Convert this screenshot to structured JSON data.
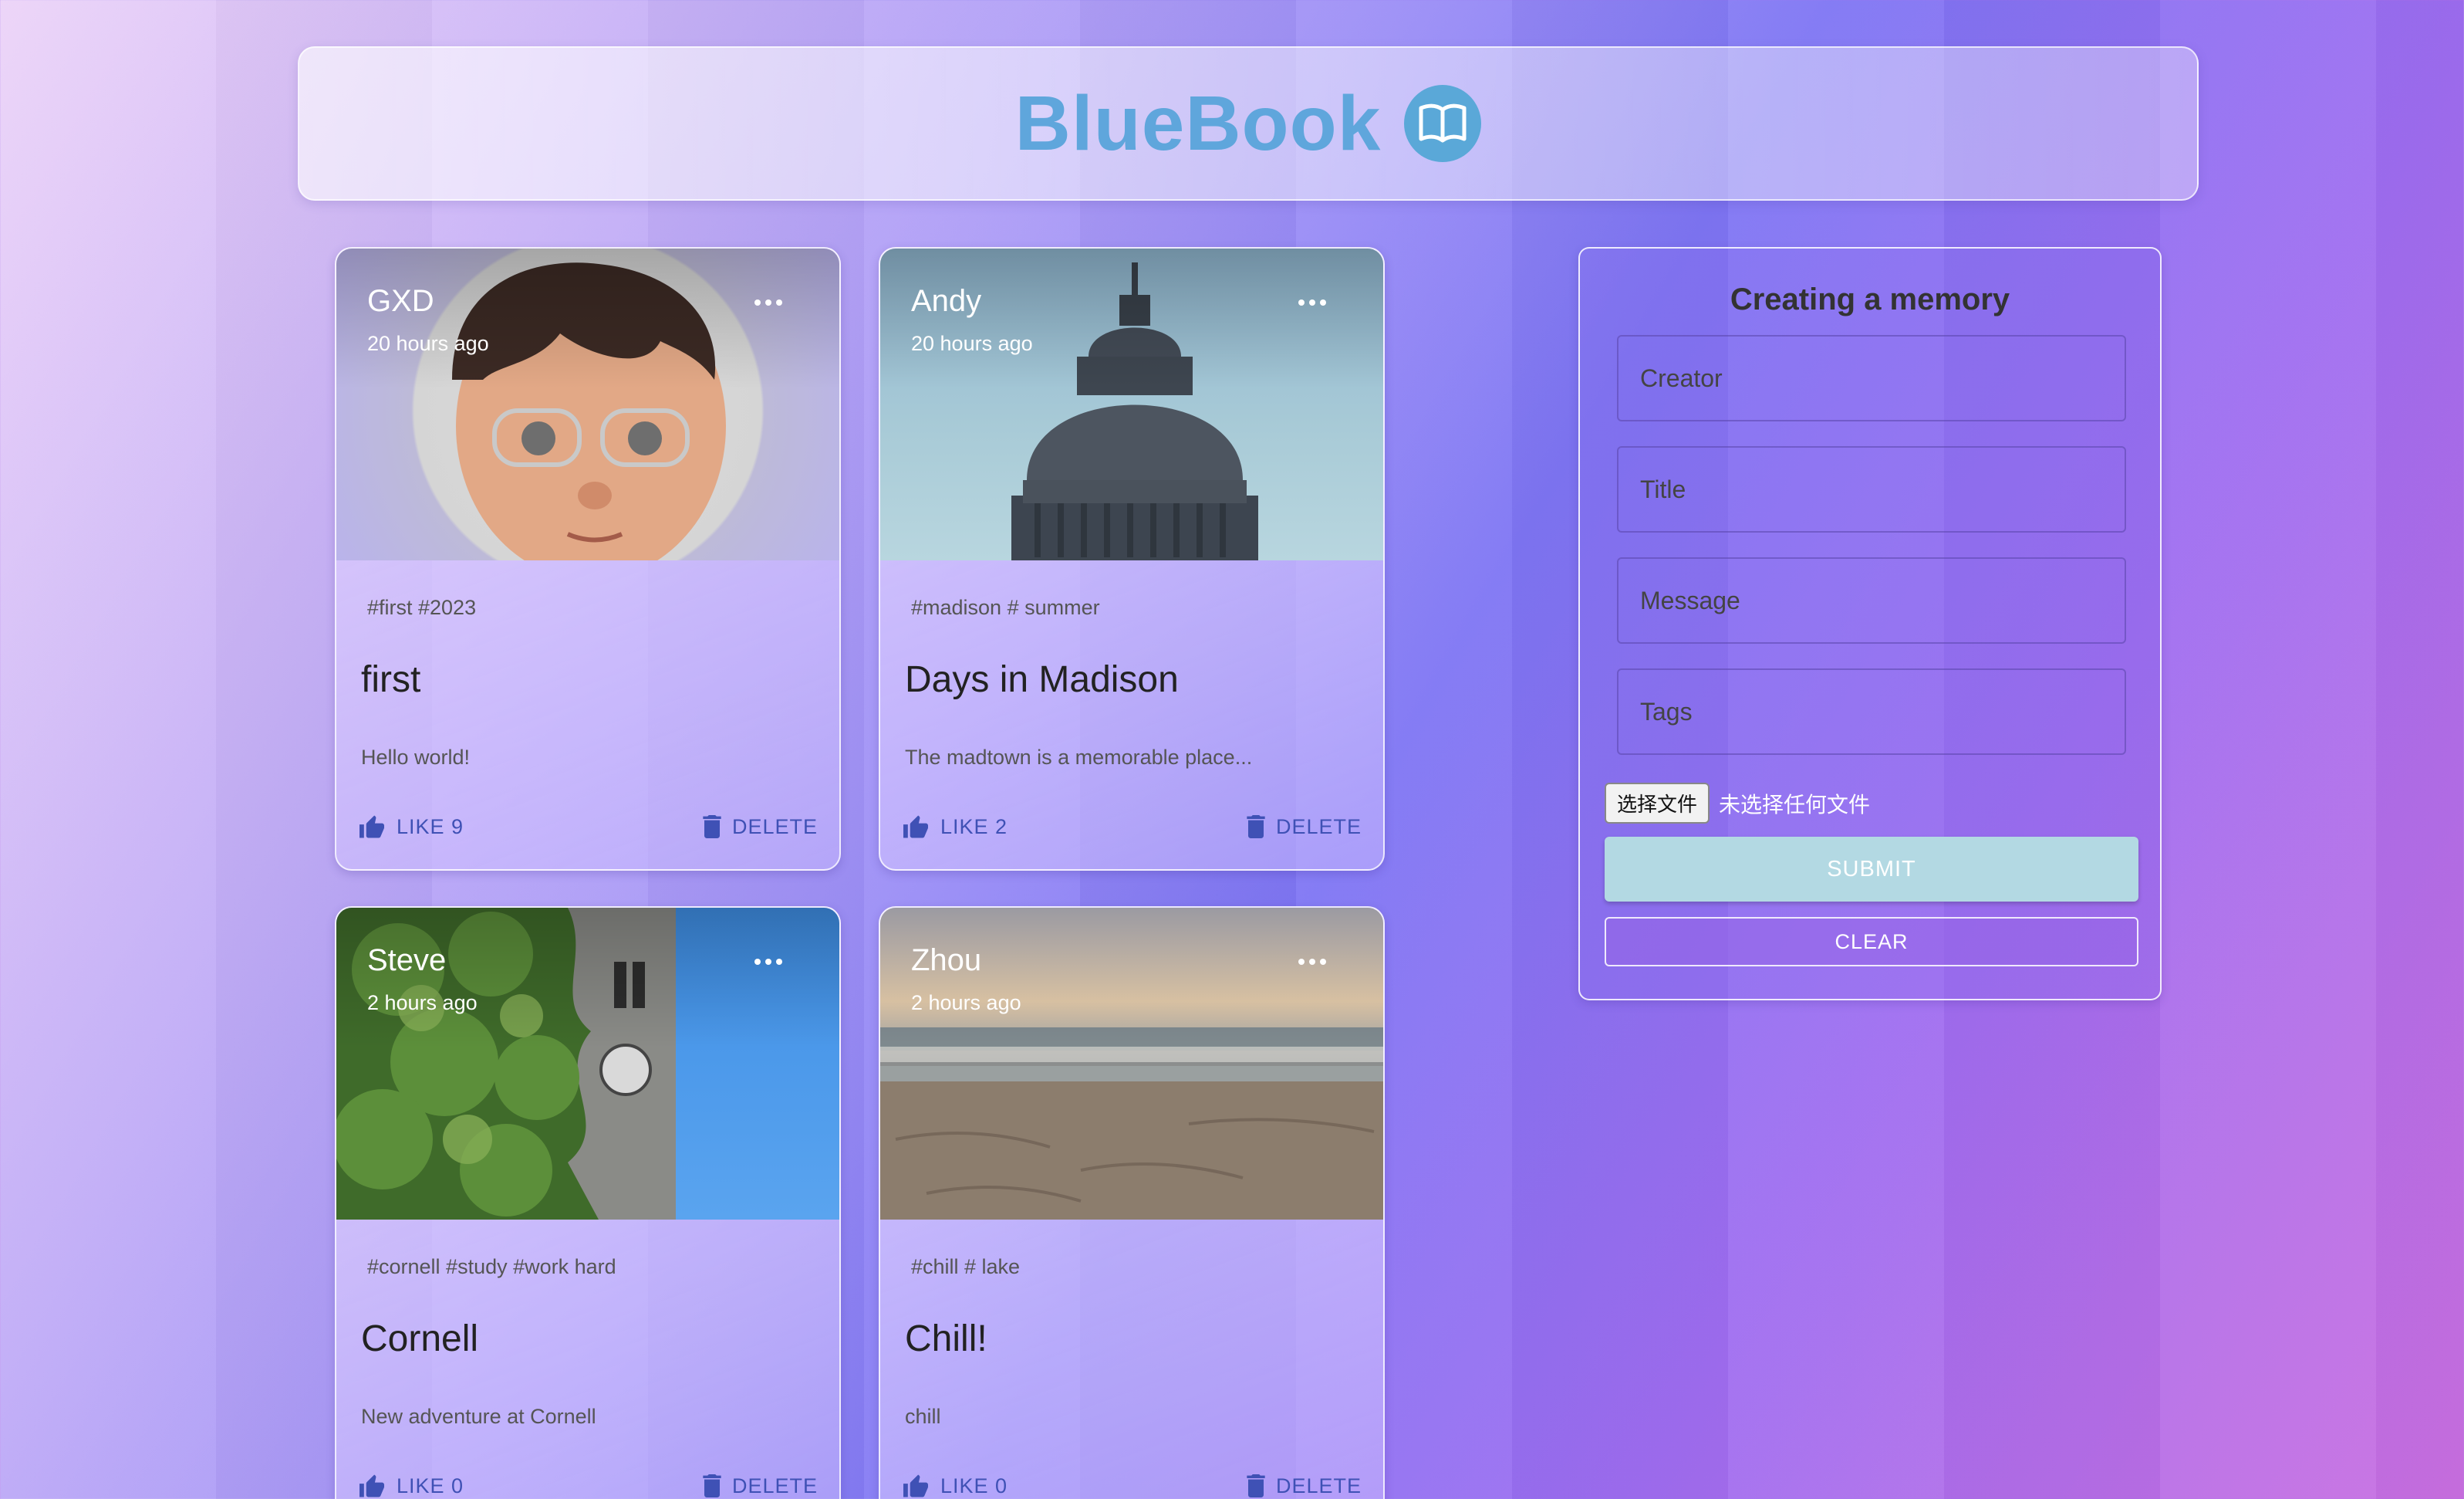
{
  "app": {
    "title": "BlueBook",
    "logo_icon": "open-book-icon",
    "brand_color": "#5fa6dc"
  },
  "posts": [
    {
      "creator": "GXD",
      "time": "20 hours ago",
      "tags": "#first #2023",
      "title": "first",
      "message": "Hello world!",
      "like_label": "LIKE 9",
      "delete_label": "DELETE",
      "image": "avatar-memoji"
    },
    {
      "creator": "Andy",
      "time": "20 hours ago",
      "tags": "#madison # summer",
      "title": "Days in Madison",
      "message": "The madtown is a memorable place...",
      "like_label": "LIKE 2",
      "delete_label": "DELETE",
      "image": "capitol-dome"
    },
    {
      "creator": "Steve",
      "time": "2 hours ago",
      "tags": "#cornell #study #work hard",
      "title": "Cornell",
      "message": "New adventure at Cornell",
      "like_label": "LIKE 0",
      "delete_label": "DELETE",
      "image": "clock-tower-tree"
    },
    {
      "creator": "Zhou",
      "time": "2 hours ago",
      "tags": "#chill # lake",
      "title": "Chill!",
      "message": "chill",
      "like_label": "LIKE 0",
      "delete_label": "DELETE",
      "image": "lake-beach"
    }
  ],
  "form": {
    "title": "Creating a memory",
    "creator_placeholder": "Creator",
    "title_placeholder": "Title",
    "message_placeholder": "Message",
    "tags_placeholder": "Tags",
    "file_button": "选择文件",
    "file_status": "未选择任何文件",
    "submit_label": "SUBMIT",
    "clear_label": "CLEAR"
  },
  "colors": {
    "action": "#3f51b5",
    "submit_bg": "#b3d9e3"
  }
}
